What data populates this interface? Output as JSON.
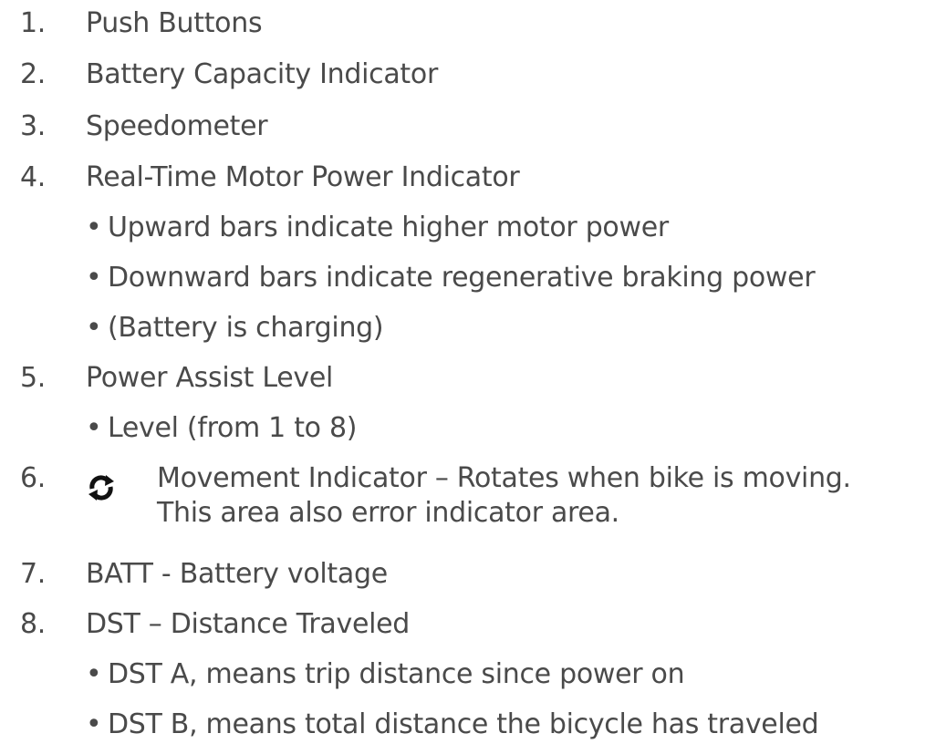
{
  "items": [
    {
      "number": "1.",
      "label": "Push Buttons",
      "sub": []
    },
    {
      "number": "2.",
      "label": "Battery Capacity Indicator",
      "sub": []
    },
    {
      "number": "3.",
      "label": "Speedometer",
      "sub": []
    },
    {
      "number": "4.",
      "label": "Real-Time Motor Power Indicator",
      "sub": [
        "Upward bars indicate higher motor power",
        "Downward bars indicate regenerative braking power",
        "(Battery is charging)"
      ]
    },
    {
      "number": "5.",
      "label": "Power Assist Level",
      "sub": [
        "Level (from 1 to 8)"
      ]
    },
    {
      "number": "6.",
      "label": "Movement Indicator – Rotates when bike is moving.",
      "label_line2": "This area also error indicator area.",
      "icon": "rotation-arrows-icon",
      "sub": []
    },
    {
      "number": "7.",
      "label": "BATT - Battery voltage",
      "sub": []
    },
    {
      "number": "8.",
      "label": "DST – Distance Traveled",
      "sub": [
        "DST A, means trip distance since power on",
        "DST B, means total distance the bicycle has traveled"
      ]
    }
  ],
  "bullet": "•",
  "colors": {
    "text": "#4a4a4a",
    "icon": "#111111"
  }
}
